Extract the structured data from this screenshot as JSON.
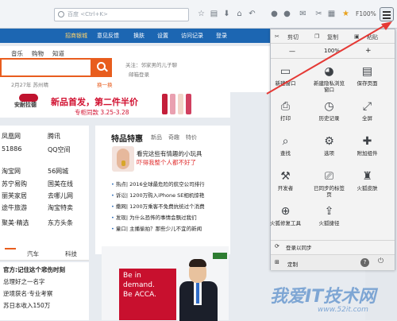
{
  "browser": {
    "url_placeholder": "百度 <Ctrl+K>",
    "zoom_top": "F100%"
  },
  "page": {
    "nav": {
      "brand": "招商银城",
      "items": [
        "意见反馈",
        "换肤",
        "设置",
        "访问记录",
        "登录"
      ]
    },
    "sub_links": [
      "音乐",
      "购物",
      "知道"
    ],
    "search_hint": "2月27年 苏州晴",
    "hint2": "换一换",
    "tip1": "关注：邻家男的儿子聊",
    "tip2": "邮箱登录",
    "banner": {
      "logo": "安耐拉德",
      "main": "新品首发，第二件半价",
      "sub": "专柜同款 3.25-3.28"
    },
    "sites": [
      [
        "凤凰网",
        "腾讯"
      ],
      [
        "51886",
        "QQ空间"
      ],
      [
        "淘宝网",
        "56网城"
      ],
      [
        "苏宁易购",
        "国美在线"
      ],
      [
        "丽芙家居",
        "去哪儿网"
      ],
      [
        "途牛旅游",
        "淘宝特卖"
      ],
      [
        "聚美·精选",
        "东方头条"
      ]
    ],
    "special": {
      "title": "特品特惠",
      "tabs": [
        "新品",
        "奇趣",
        "特价"
      ],
      "promo_line1": "看完这些有情趣的小玩具",
      "promo_red": "吓得我整个人都不好了",
      "news": [
        "热点| 2016全球最危险的航空公司排行",
        "诉讼| 1200万购入iPhone SE相机惊艳",
        "撒网| 1200万乘客不免费抗统过个消费",
        "发现| 为什么恐怖的事情会飘过我们",
        "童口| 主播偷拍？那些少儿不宜的新闻"
      ]
    },
    "bottom_tabs": [
      "汽车",
      "科技"
    ],
    "headlines": [
      "官方:记住这个悲伤时刻",
      "总理好之一名字",
      "逆境获名·专业考察",
      "苏日本收入150万"
    ],
    "ad": {
      "line1": "Be in",
      "line2": "demand.",
      "line3": "Be ACCA."
    }
  },
  "menu": {
    "top_row": [
      "剪切",
      "复制",
      "粘贴"
    ],
    "zoom_minus": "—",
    "zoom": "100%",
    "zoom_plus": "+",
    "items": [
      {
        "label": "新建窗口",
        "icon": "window-icon"
      },
      {
        "label": "新建隐私浏览窗口",
        "icon": "private-mask-icon"
      },
      {
        "label": "保存页面",
        "icon": "save-icon"
      },
      {
        "label": "打印",
        "icon": "print-icon"
      },
      {
        "label": "历史记录",
        "icon": "clock-icon"
      },
      {
        "label": "全屏",
        "icon": "fullscreen-icon"
      },
      {
        "label": "查找",
        "icon": "search-icon"
      },
      {
        "label": "选项",
        "icon": "gear-icon"
      },
      {
        "label": "附加组件",
        "icon": "puzzle-icon"
      },
      {
        "label": "开发者",
        "icon": "wrench-icon"
      },
      {
        "label": "已同步的标签页",
        "icon": "sync-tabs-icon"
      },
      {
        "label": "火狐皮肤",
        "icon": "shirt-icon"
      },
      {
        "label": "火狐修复工具",
        "icon": "toolbox-icon"
      },
      {
        "label": "火狐捷径",
        "icon": "share-icon"
      }
    ],
    "sync": "登录以同步",
    "customize": "定制"
  },
  "watermark": {
    "main": "我爱IT技术网",
    "url": "www.52it.com"
  },
  "colors": {
    "menu_bg": "#f3f3f3",
    "accent_orange": "#e85d1e",
    "nav_blue": "#1c66b2",
    "arrow_red": "#e53935"
  }
}
